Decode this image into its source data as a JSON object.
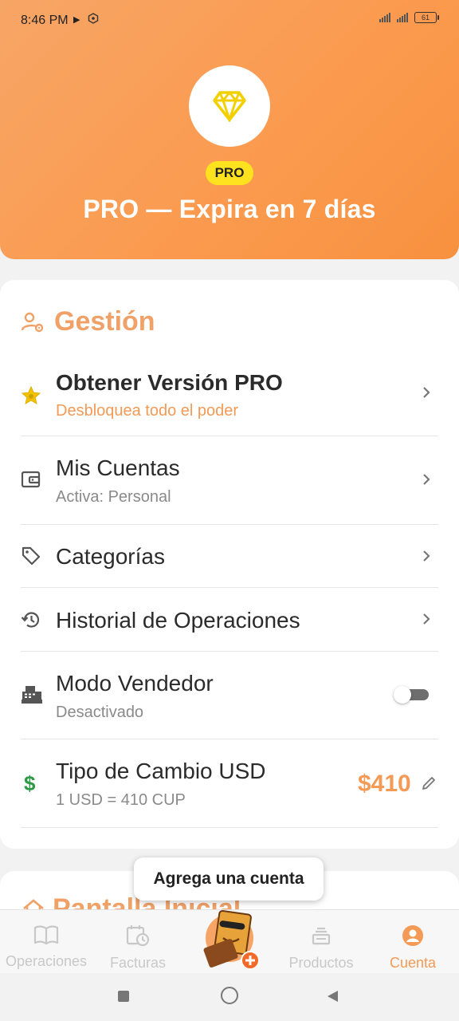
{
  "status": {
    "time": "8:46 PM",
    "battery": "61"
  },
  "header": {
    "badge": "PRO",
    "title": "PRO — Expira en 7 días"
  },
  "section": {
    "title": "Gestión"
  },
  "rows": [
    {
      "title": "Obtener Versión PRO",
      "subtitle": "Desbloquea todo el poder"
    },
    {
      "title": "Mis Cuentas",
      "subtitle": "Activa: Personal"
    },
    {
      "title": "Categorías",
      "subtitle": ""
    },
    {
      "title": "Historial de Operaciones",
      "subtitle": ""
    },
    {
      "title": "Modo Vendedor",
      "subtitle": "Desactivado"
    },
    {
      "title": "Tipo de Cambio USD",
      "subtitle": "1 USD = 410 CUP",
      "value": "$410"
    }
  ],
  "seller_mode_enabled": false,
  "section2": {
    "title": "Pantalla Inicial"
  },
  "tooltip": "Agrega una cuenta",
  "nav": {
    "items": [
      {
        "label": "Operaciones",
        "icon": "book-icon"
      },
      {
        "label": "Facturas",
        "icon": "calendar-clock-icon"
      },
      {
        "label": "Productos",
        "icon": "products-icon"
      },
      {
        "label": "Cuenta",
        "icon": "account-icon"
      }
    ],
    "active": "Cuenta"
  },
  "colors": {
    "accent": "#f39a56",
    "header": "#fb9a4e",
    "badge": "#ffe21f",
    "gold": "#f2c200",
    "dollar": "#2e9a46"
  }
}
